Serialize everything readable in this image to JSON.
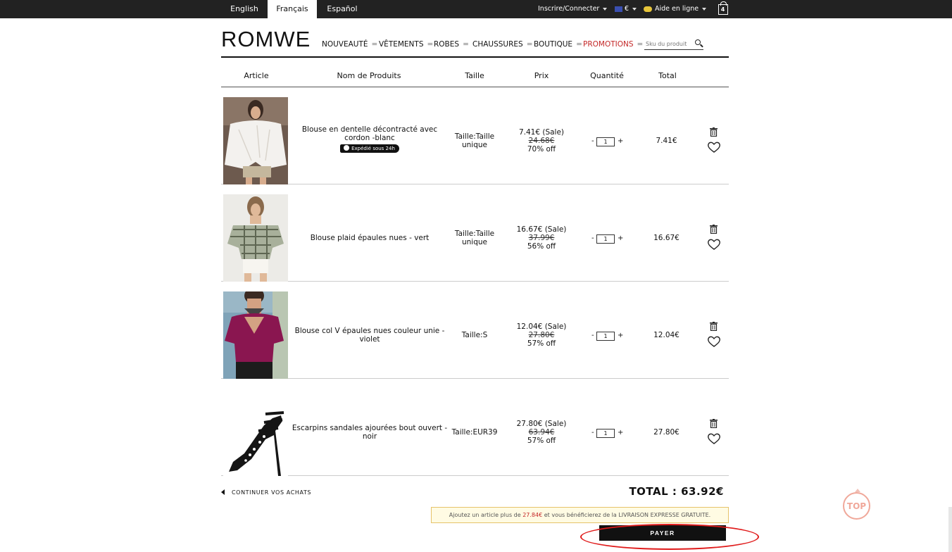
{
  "topbar": {
    "languages": [
      {
        "label": "English",
        "active": false
      },
      {
        "label": "Français",
        "active": true
      },
      {
        "label": "Español",
        "active": false
      }
    ],
    "login": "Inscrire/Connecter",
    "currency": "€",
    "help": "Aide en ligne",
    "cart_count": "4"
  },
  "header": {
    "logo": "ROMWE",
    "nav": [
      {
        "label": "NOUVEAUTÉ",
        "promo": false
      },
      {
        "label": "VÊTEMENTS",
        "promo": false
      },
      {
        "label": "ROBES",
        "promo": false
      },
      {
        "label": "CHAUSSURES",
        "promo": false
      },
      {
        "label": "BOUTIQUE",
        "promo": false
      },
      {
        "label": "PROMOTIONS",
        "promo": true
      }
    ],
    "search_placeholder": "Sku du produit"
  },
  "table": {
    "headers": {
      "article": "Article",
      "name": "Nom de Produits",
      "size": "Taille",
      "price": "Prix",
      "qty": "Quantité",
      "total": "Total"
    },
    "rows": [
      {
        "name": "Blouse en dentelle décontracté avec cordon -blanc",
        "badge": "Expédié sous 24h",
        "size": "Taille:Taille unique",
        "price_sale": "7.41€ (Sale)",
        "price_old": "24.68€",
        "discount": "70% off",
        "qty": "1",
        "total": "7.41€"
      },
      {
        "name": "Blouse plaid épaules nues - vert",
        "badge": "",
        "size": "Taille:Taille unique",
        "price_sale": "16.67€ (Sale)",
        "price_old": "37.99€",
        "discount": "56% off",
        "qty": "1",
        "total": "16.67€"
      },
      {
        "name": "Blouse col V épaules nues couleur unie - violet",
        "badge": "",
        "size": "Taille:S",
        "price_sale": "12.04€ (Sale)",
        "price_old": "27.80€",
        "discount": "57% off",
        "qty": "1",
        "total": "12.04€"
      },
      {
        "name": "Escarpins sandales ajourées bout ouvert - noir",
        "badge": "",
        "size": "Taille:EUR39",
        "price_sale": "27.80€ (Sale)",
        "price_old": "63.94€",
        "discount": "57% off",
        "qty": "1",
        "total": "27.80€"
      }
    ]
  },
  "footer": {
    "continue": "CONTINUER VOS ACHATS",
    "total": "TOTAL : 63.92€",
    "notice_pre": "Ajoutez un article plus de ",
    "notice_amount": "27.84€",
    "notice_post": " et vous bénéficierez de la LIVRAISON EXPRESSE GRATUITE.",
    "pay": "PAYER",
    "top": "TOP"
  },
  "colors": {
    "promo": "#c42828",
    "topbar": "#222222",
    "annotation": "#e01b1b"
  }
}
